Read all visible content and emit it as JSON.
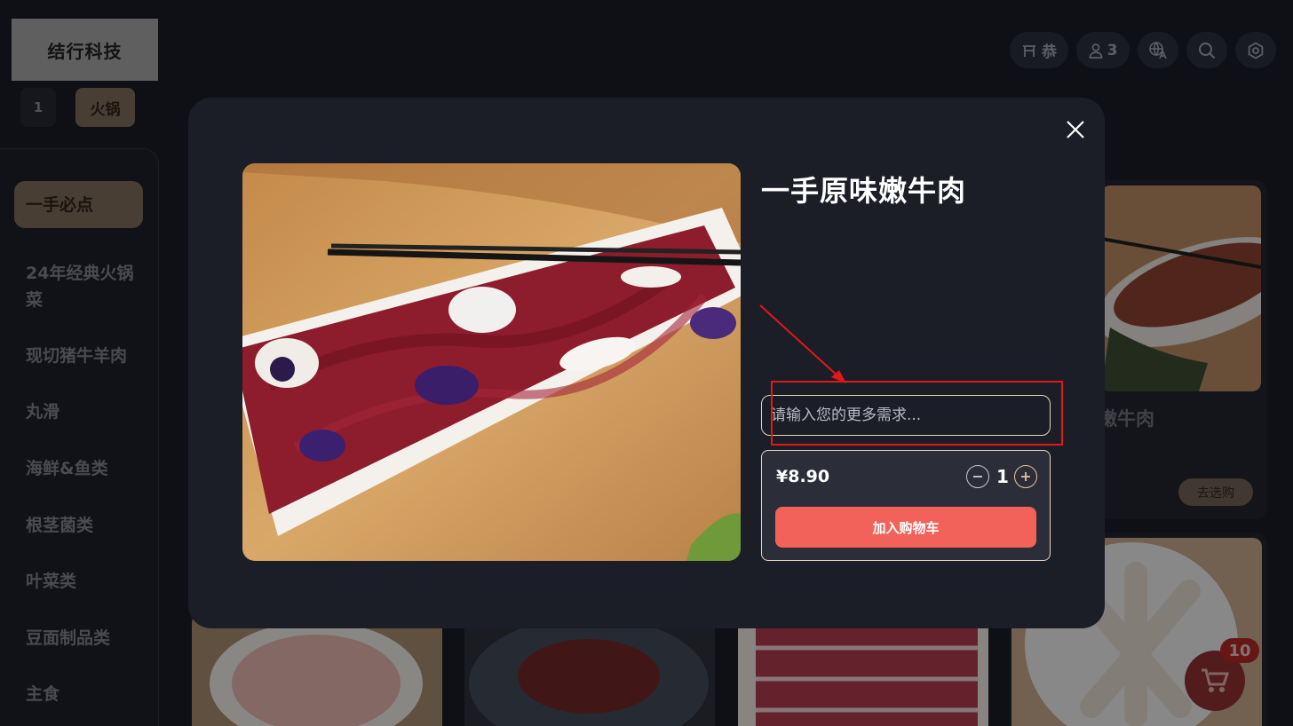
{
  "brand": {
    "name": "结行科技"
  },
  "table": {
    "number": "1",
    "menu_tab": "火锅"
  },
  "topbar": {
    "store_label": "恭",
    "guest_count": "3",
    "icons": [
      "store-icon",
      "user-icon",
      "translate-icon",
      "search-icon",
      "settings-icon"
    ]
  },
  "sidebar": {
    "categories": [
      "一手必点",
      "24年经典火锅菜",
      "现切猪牛羊肉",
      "丸滑",
      "海鲜&鱼类",
      "根茎菌类",
      "叶菜类",
      "豆面制品类",
      "主食"
    ],
    "active_index": 0
  },
  "background_card": {
    "name_fragment": "嫩牛肉",
    "choose_label": "去选购"
  },
  "cart": {
    "count": "10"
  },
  "modal": {
    "title": "一手原味嫩牛肉",
    "note_placeholder": "请输入您的更多需求...",
    "price": "¥8.90",
    "quantity": "1",
    "add_to_cart_label": "加入购物车"
  },
  "colors": {
    "accent": "#7c6a56",
    "add_button": "#f2625b",
    "annotation": "#e2171b",
    "modal_bg": "#1b1e27"
  }
}
